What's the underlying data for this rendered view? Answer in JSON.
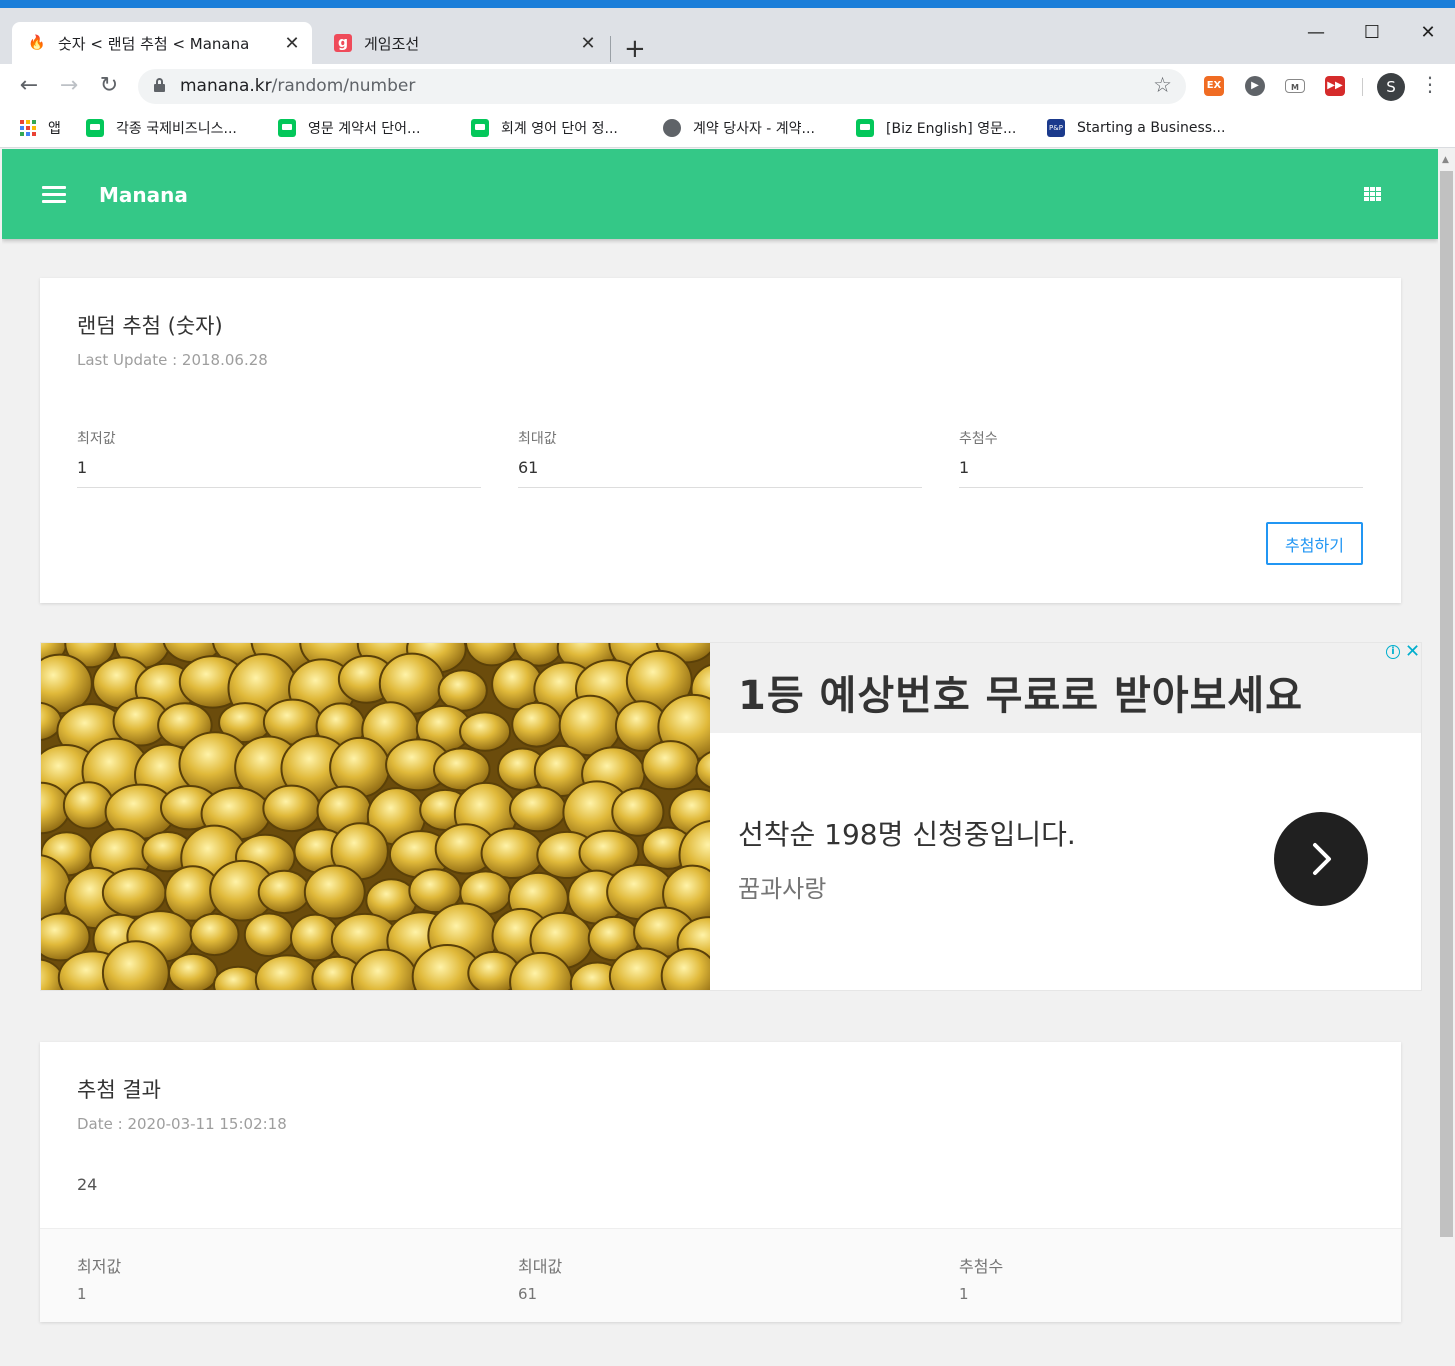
{
  "browser": {
    "tabs": [
      {
        "title": "숫자 < 랜덤 추첨 < Manana",
        "active": true
      },
      {
        "title": "게임조선",
        "active": false
      }
    ],
    "url_host": "manana.kr",
    "url_path": "/random/number",
    "extensions": [
      "EX",
      "▶",
      "M",
      "▶▶"
    ],
    "profile_initial": "S",
    "bookmarks": [
      {
        "label": "앱",
        "icon": "apps-icon"
      },
      {
        "label": "각종 국제비즈니스...",
        "icon": "naver-icon"
      },
      {
        "label": "영문 계약서 단어...",
        "icon": "naver-icon"
      },
      {
        "label": "회계 영어 단어 정...",
        "icon": "naver-icon"
      },
      {
        "label": "계약 당사자 - 계약...",
        "icon": "globe-icon"
      },
      {
        "label": "[Biz English] 영문...",
        "icon": "naver-icon"
      },
      {
        "label": "Starting a Business...",
        "icon": "pp-icon"
      }
    ],
    "pp_icon_text": "P&P"
  },
  "app": {
    "title": "Manana",
    "accent_color": "#34c887"
  },
  "draw_card": {
    "title": "랜덤 추첨 (숫자)",
    "subtitle": "Last Update : 2018.06.28",
    "fields": [
      {
        "label": "최저값",
        "value": "1"
      },
      {
        "label": "최대값",
        "value": "61"
      },
      {
        "label": "추첨수",
        "value": "1"
      }
    ],
    "button_label": "추첨하기"
  },
  "ad": {
    "headline": "1등 예상번호 무료로 받아보세요",
    "description": "선착순 198명 신청중입니다.",
    "brand": "꿈과사랑",
    "info_icon": "i",
    "close_icon": "✕"
  },
  "result_card": {
    "title": "추첨 결과",
    "date": "Date : 2020-03-11 15:02:18",
    "result": "24",
    "summary": [
      {
        "label": "최저값",
        "value": "1"
      },
      {
        "label": "최대값",
        "value": "61"
      },
      {
        "label": "추첨수",
        "value": "1"
      }
    ]
  }
}
